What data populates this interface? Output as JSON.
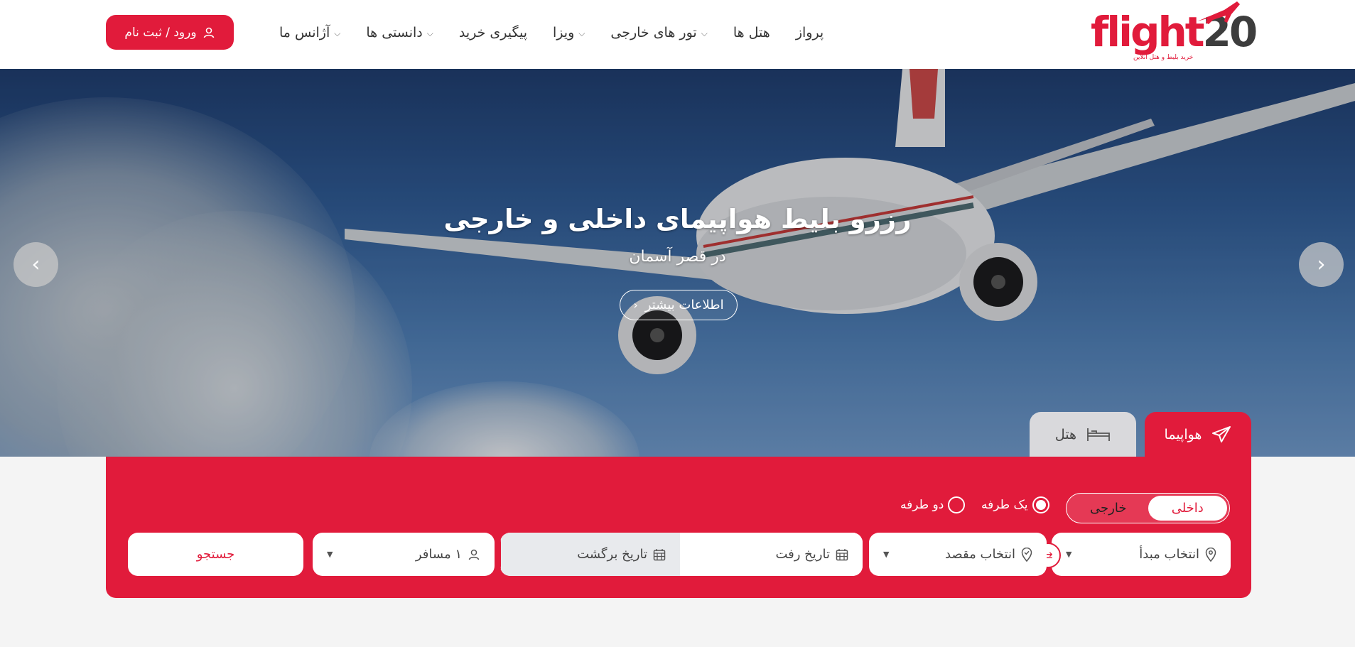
{
  "header": {
    "logo_text": "flight",
    "logo_num": "20",
    "logo_sub": "خرید بلیط و هتل آنلاین",
    "login_label": "ورود / ثبت نام",
    "nav": [
      {
        "label": "پرواز",
        "dropdown": false
      },
      {
        "label": "هتل ها",
        "dropdown": false
      },
      {
        "label": "تور های خارجی",
        "dropdown": true
      },
      {
        "label": "ویزا",
        "dropdown": true
      },
      {
        "label": "پیگیری خرید",
        "dropdown": false
      },
      {
        "label": "دانستی ها",
        "dropdown": true
      },
      {
        "label": "آژانس ما",
        "dropdown": true
      }
    ]
  },
  "hero": {
    "title": "رزرو بلیط هواپیمای داخلی و خارجی",
    "subtitle": "در قصر آسمان",
    "more_label": "اطلاعات بیشتر"
  },
  "tabs": {
    "flight": "هواپیما",
    "hotel": "هتل"
  },
  "search": {
    "scope_domestic": "داخلی",
    "scope_foreign": "خارجی",
    "trip_oneway": "یک طرفه",
    "trip_round": "دو طرفه",
    "origin_placeholder": "انتخاب مبدأ",
    "dest_placeholder": "انتخاب مقصد",
    "depart_date": "تاریخ رفت",
    "return_date": "تاریخ برگشت",
    "passengers": "۱ مسافر",
    "search_button": "جستجو"
  },
  "colors": {
    "brand": "#e11b3b",
    "logo_dark": "#3d3d3d"
  }
}
